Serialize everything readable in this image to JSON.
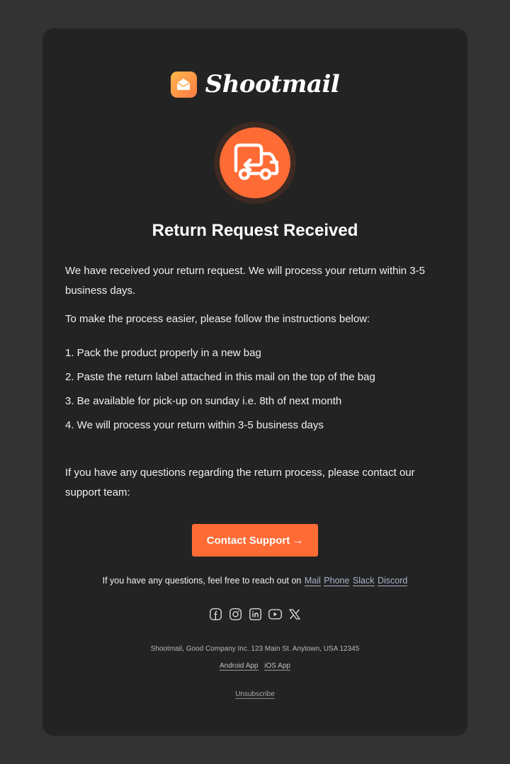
{
  "brand": {
    "name": "Shootmail",
    "logo_icon": "envelope-open-icon",
    "logo_gradient": [
      "#ffb84a",
      "#ff7a45"
    ]
  },
  "hero": {
    "icon": "truck-return-icon",
    "accent": "#ff6b35"
  },
  "email": {
    "title": "Return Request Received",
    "intro": "We have received your return request. We will process your return within 3-5 business days.",
    "instructions_lead": "To make the process easier, please follow the instructions below:",
    "steps": [
      "1. Pack the product properly in a new bag",
      "2. Paste the return label attached in this mail on the top of the bag",
      "3. Be available for pick-up on sunday i.e. 8th of next month",
      "4. We will process your return within 3-5 business days"
    ],
    "questions": "If you have any questions regarding the return process, please contact our support team:",
    "cta_label": "Contact Support",
    "cta_arrow": "→"
  },
  "contact": {
    "lead": "If you have any questions, feel free to reach out on",
    "links": [
      "Mail",
      "Phone",
      "Slack",
      "Discord"
    ]
  },
  "socials": [
    {
      "name": "facebook",
      "icon": "facebook-icon"
    },
    {
      "name": "instagram",
      "icon": "instagram-icon"
    },
    {
      "name": "linkedin",
      "icon": "linkedin-icon"
    },
    {
      "name": "youtube",
      "icon": "youtube-icon"
    },
    {
      "name": "x",
      "icon": "x-icon"
    }
  ],
  "footer": {
    "address": "Shootmail, Good Company Inc. 123 Main St. Anytown, USA 12345",
    "app_links": [
      "Android App",
      "iOS App"
    ],
    "unsubscribe": "Unsubscribe"
  },
  "colors": {
    "page_bg": "#333333",
    "card_bg": "#232323",
    "accent": "#ff6b35",
    "link": "#a8b4c8"
  }
}
